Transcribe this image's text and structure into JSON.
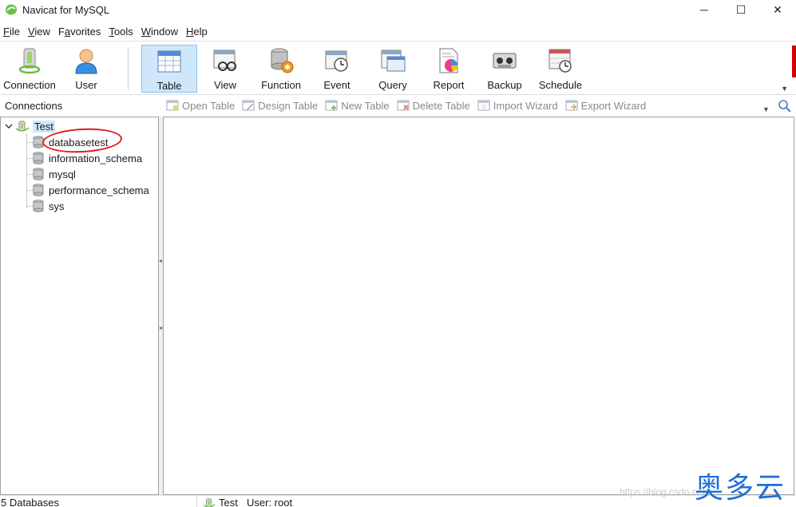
{
  "window": {
    "title": "Navicat for MySQL",
    "controls": {
      "minimize": "─",
      "maximize": "☐",
      "close": "✕"
    }
  },
  "menu": [
    {
      "acc": "F",
      "rest": "ile"
    },
    {
      "acc": "V",
      "rest": "iew"
    },
    {
      "pre": "F",
      "acc": "a",
      "rest": "vorites"
    },
    {
      "acc": "T",
      "rest": "ools"
    },
    {
      "acc": "W",
      "rest": "indow"
    },
    {
      "acc": "H",
      "rest": "elp"
    }
  ],
  "toolbar": {
    "connection": "Connection",
    "user": "User",
    "table": "Table",
    "view": "View",
    "function": "Function",
    "event": "Event",
    "query": "Query",
    "report": "Report",
    "backup": "Backup",
    "schedule": "Schedule",
    "active": "Table"
  },
  "subbar": {
    "connections_label": "Connections",
    "open_table": "Open Table",
    "design_table": "Design Table",
    "new_table": "New Table",
    "delete_table": "Delete Table",
    "import_wizard": "Import Wizard",
    "export_wizard": "Export Wizard"
  },
  "tree": {
    "connection": "Test",
    "databases": [
      "databasetest",
      "information_schema",
      "mysql",
      "performance_schema",
      "sys"
    ]
  },
  "status": {
    "count": "5 Databases",
    "connection": "Test",
    "user": "User: root"
  },
  "watermark": {
    "url": "https://blog.csdn.net/...",
    "brand": "奥多云"
  },
  "colors": {
    "selection": "#cfe6fb",
    "annotation": "#e11b1b",
    "brand": "#1d6fd8"
  }
}
